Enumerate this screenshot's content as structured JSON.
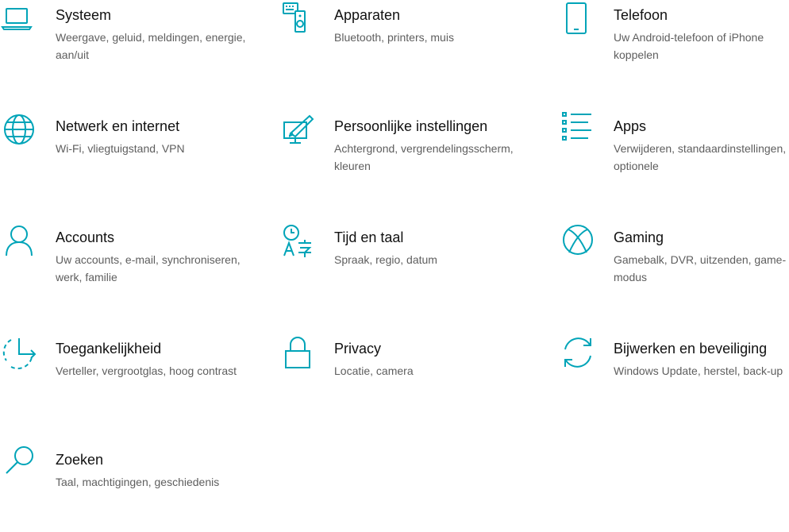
{
  "accent": "#00a4b8",
  "tiles": [
    {
      "title": "Systeem",
      "desc": "Weergave, geluid, meldingen, energie, aan/uit",
      "icon": "laptop-icon"
    },
    {
      "title": "Apparaten",
      "desc": "Bluetooth, printers, muis",
      "icon": "devices-icon"
    },
    {
      "title": "Telefoon",
      "desc": "Uw Android-telefoon of iPhone koppelen",
      "icon": "phone-icon"
    },
    {
      "title": "Netwerk en internet",
      "desc": "Wi-Fi, vliegtuigstand, VPN",
      "icon": "globe-icon"
    },
    {
      "title": "Persoonlijke instellingen",
      "desc": "Achtergrond, vergrendelingsscherm, kleuren",
      "icon": "personalization-icon"
    },
    {
      "title": "Apps",
      "desc": "Verwijderen, standaardinstellingen, optionele",
      "icon": "apps-list-icon"
    },
    {
      "title": "Accounts",
      "desc": "Uw accounts, e-mail, synchroniseren, werk, familie",
      "icon": "person-icon"
    },
    {
      "title": "Tijd en taal",
      "desc": "Spraak, regio, datum",
      "icon": "time-language-icon"
    },
    {
      "title": "Gaming",
      "desc": "Gamebalk, DVR, uitzenden, game-modus",
      "icon": "xbox-icon"
    },
    {
      "title": "Toegankelijkheid",
      "desc": "Verteller, vergrootglas, hoog contrast",
      "icon": "ease-of-access-icon"
    },
    {
      "title": "Privacy",
      "desc": "Locatie, camera",
      "icon": "lock-icon"
    },
    {
      "title": "Bijwerken en beveiliging",
      "desc": "Windows Update, herstel, back-up",
      "icon": "sync-arrows-icon"
    },
    {
      "title": "Zoeken",
      "desc": "Taal, machtigingen, geschiedenis",
      "icon": "search-icon"
    }
  ]
}
